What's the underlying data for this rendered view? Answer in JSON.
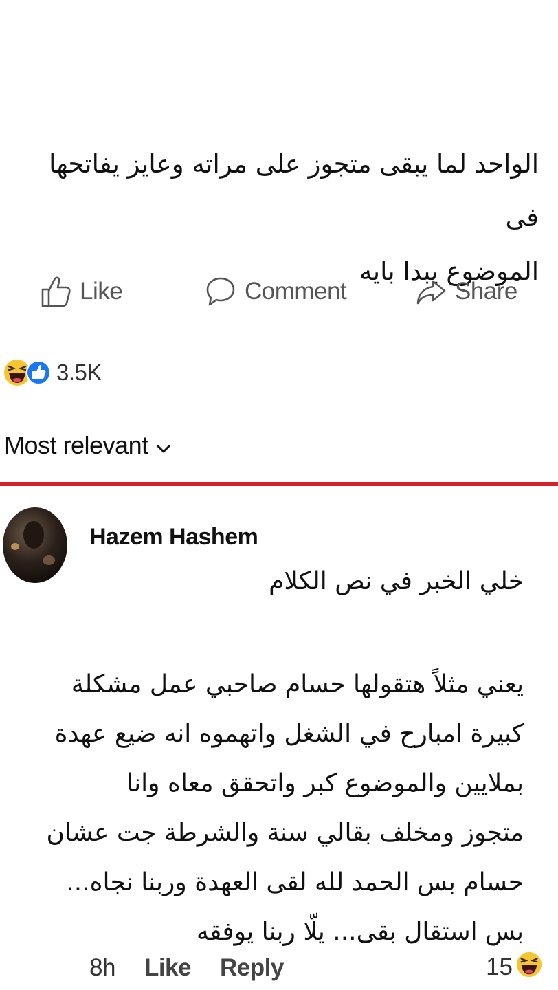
{
  "post": {
    "text_line1": "الواحد لما يبقى متجوز على مراته وعايز يفاتحها فى",
    "text_line2": "الموضوع يبدا بايه"
  },
  "actions": {
    "like_label": "Like",
    "comment_label": "Comment",
    "share_label": "Share"
  },
  "reactions": {
    "icons": [
      "haha-emoji-icon",
      "like-reaction-icon"
    ],
    "count": "3.5K"
  },
  "sort": {
    "label": "Most relevant",
    "icon": "chevron-down-icon"
  },
  "colors": {
    "divider": "#d81e2a",
    "like_blue": "#1877f2",
    "haha_yellow": "#f7c531"
  },
  "comment": {
    "author": "Hazem Hashem",
    "lines": [
      "خلي الخبر في نص الكلام",
      "يعني مثلاً هتقولها حسام صاحبي عمل مشكلة",
      "كبيرة امبارح في الشغل واتهموه انه ضيع عهدة",
      "بملايين والموضوع كبر واتحقق معاه وانا",
      "متجوز ومخلف بقالي سنة والشرطة جت عشان",
      "حسام بس الحمد لله لقى العهدة وربنا نجاه...",
      "بس استقال بقى... يلّا ربنا يوفقه"
    ],
    "time": "8h",
    "like_label": "Like",
    "reply_label": "Reply",
    "reaction_count": "15",
    "reaction_icon": "haha-emoji-icon"
  }
}
